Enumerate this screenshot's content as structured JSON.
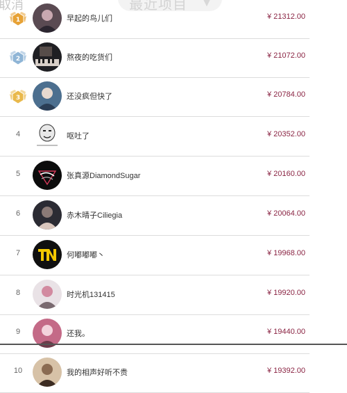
{
  "header": {
    "cancel_label": "取消",
    "recent_label": "最近项目"
  },
  "currency_symbol": "¥",
  "rows": [
    {
      "rank": "1",
      "name": "早起的鸟儿们",
      "amount": "21312.00",
      "medal": "gold",
      "avatar": "avatar-photo"
    },
    {
      "rank": "2",
      "name": "熬夜的吃货们",
      "amount": "21072.00",
      "medal": "silver",
      "avatar": "avatar-piano"
    },
    {
      "rank": "3",
      "name": "还没疯但快了",
      "amount": "20784.00",
      "medal": "bronze",
      "avatar": "avatar-photo"
    },
    {
      "rank": "4",
      "name": "呕吐了",
      "amount": "20352.00",
      "medal": "",
      "avatar": "avatar-meme"
    },
    {
      "rank": "5",
      "name": "张真源DiamondSugar",
      "amount": "20160.00",
      "medal": "",
      "avatar": "avatar-diamond"
    },
    {
      "rank": "6",
      "name": "赤木晴子Ciliegia",
      "amount": "20064.00",
      "medal": "",
      "avatar": "avatar-photo"
    },
    {
      "rank": "7",
      "name": "何嘟嘟嘟丶",
      "amount": "19968.00",
      "medal": "",
      "avatar": "avatar-tnt"
    },
    {
      "rank": "8",
      "name": "时光机131415",
      "amount": "19920.00",
      "medal": "",
      "avatar": "avatar-photo"
    },
    {
      "rank": "9",
      "name": "还我。",
      "amount": "19440.00",
      "medal": "",
      "avatar": "avatar-photo"
    },
    {
      "rank": "10",
      "name": "我的相声好听不贵",
      "amount": "19392.00",
      "medal": "",
      "avatar": "avatar-photo"
    }
  ],
  "colors": {
    "amount": "#8a2443",
    "gold": "#e7a236",
    "silver": "#8fb5d6",
    "bronze": "#e9b94c"
  }
}
